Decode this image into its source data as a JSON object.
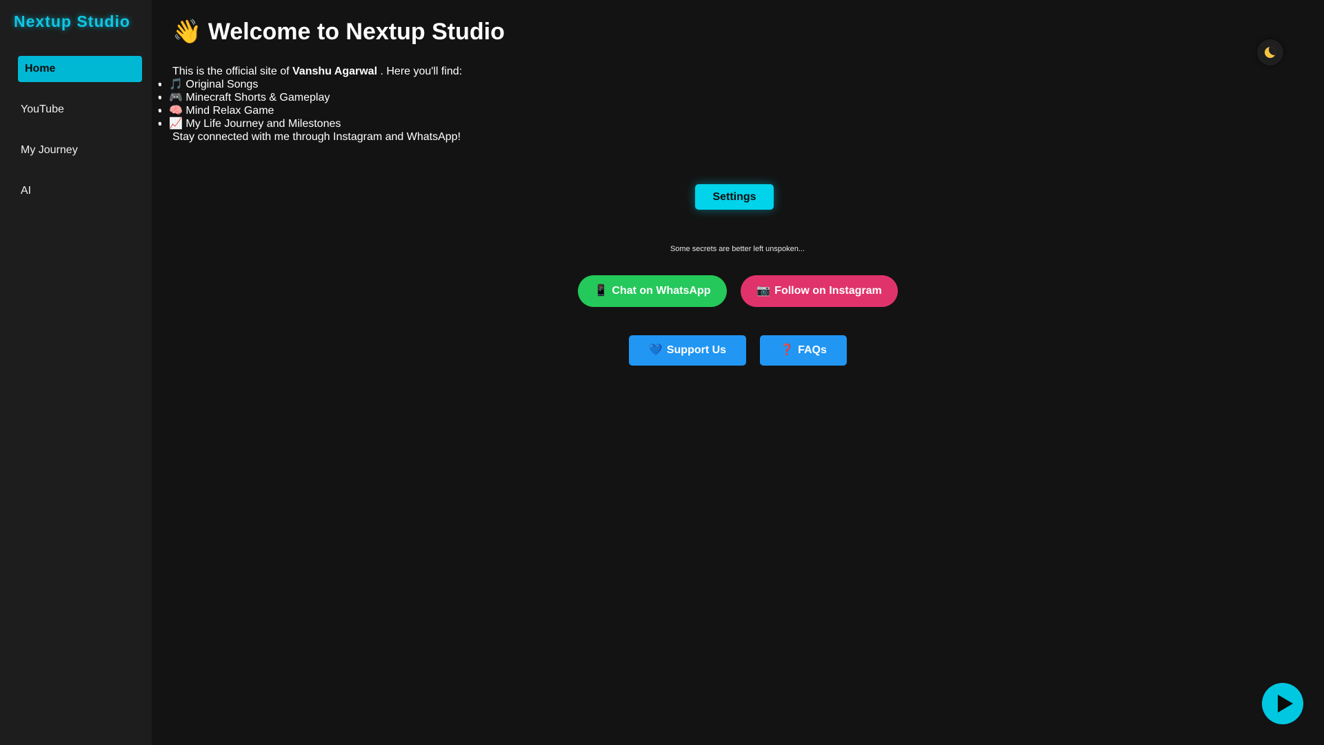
{
  "sidebar": {
    "brand": "Nextup Studio",
    "items": [
      {
        "label": "Home",
        "active": true
      },
      {
        "label": "YouTube",
        "active": false
      },
      {
        "label": "My Journey",
        "active": false
      },
      {
        "label": "AI",
        "active": false
      }
    ]
  },
  "main": {
    "title_icon": "👋",
    "title": "Welcome to Nextup Studio",
    "intro_prefix": "This is the official site of",
    "intro_name": "Vanshu Agarwal",
    "intro_suffix": ". Here you'll find:",
    "bullets": [
      {
        "icon": "🎵",
        "text": "Original Songs"
      },
      {
        "icon": "🎮",
        "text": "Minecraft Shorts & Gameplay"
      },
      {
        "icon": "🧠",
        "text": "Mind Relax Game"
      },
      {
        "icon": "📈",
        "text": "My Life Journey and Milestones"
      }
    ],
    "outro": "Stay connected with me through Instagram and WhatsApp!",
    "settings_label": "Settings",
    "secret_text": "Some secrets are better left unspoken...",
    "whatsapp": {
      "icon": "📱",
      "label": "Chat on WhatsApp"
    },
    "instagram": {
      "icon": "📷",
      "label": "Follow on Instagram"
    },
    "support": {
      "icon": "💙",
      "label": "Support Us"
    },
    "faqs": {
      "icon": "❓",
      "label": "FAQs"
    }
  },
  "theme_toggle_icon": "moon-icon",
  "play_icon": "play-icon",
  "colors": {
    "accent": "#00c8e0",
    "whatsapp": "#25c85a",
    "instagram": "#e0336b",
    "blue": "#2196f3",
    "background": "#131313",
    "sidebar": "#1d1d1d"
  }
}
